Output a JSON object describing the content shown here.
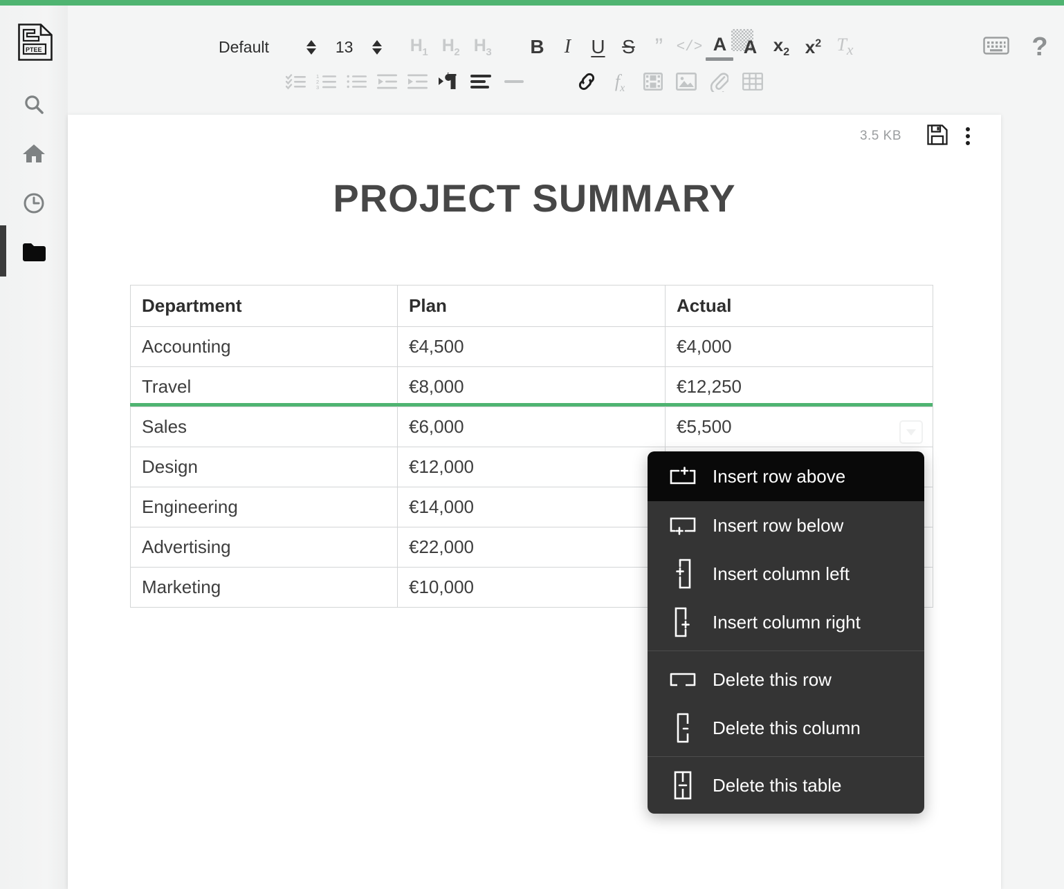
{
  "app": {
    "accent_color": "#4fb471",
    "logo_name": "ptee-document-logo"
  },
  "sidebar": {
    "items": [
      {
        "name": "search",
        "label": "Search",
        "icon": "search-icon",
        "active": false
      },
      {
        "name": "home",
        "label": "Home",
        "icon": "home-icon",
        "active": false
      },
      {
        "name": "recent",
        "label": "Recent",
        "icon": "clock-icon",
        "active": false
      },
      {
        "name": "files",
        "label": "Files",
        "icon": "folder-icon",
        "active": true
      }
    ]
  },
  "toolbar": {
    "paragraph_style": "Default",
    "font_size": "13",
    "row1": [
      {
        "name": "paragraph-style-select",
        "label": "Default",
        "type": "text"
      },
      {
        "name": "paragraph-style-stepper",
        "label": "",
        "type": "stepper"
      },
      {
        "name": "font-size-value",
        "label": "13",
        "type": "text"
      },
      {
        "name": "font-size-stepper",
        "label": "",
        "type": "stepper"
      },
      {
        "name": "heading-1-button",
        "label": "H1",
        "type": "heading",
        "enabled": false
      },
      {
        "name": "heading-2-button",
        "label": "H2",
        "type": "heading",
        "enabled": false
      },
      {
        "name": "heading-3-button",
        "label": "H3",
        "type": "heading",
        "enabled": false
      },
      {
        "name": "bold-button",
        "label": "B",
        "type": "fmt",
        "enabled": true
      },
      {
        "name": "italic-button",
        "label": "I",
        "type": "fmt",
        "enabled": true
      },
      {
        "name": "underline-button",
        "label": "U",
        "type": "fmt",
        "enabled": true
      },
      {
        "name": "strikethrough-button",
        "label": "S",
        "type": "fmt",
        "enabled": true
      },
      {
        "name": "blockquote-button",
        "label": "”",
        "type": "fmt",
        "enabled": false
      },
      {
        "name": "inline-code-button",
        "label": "</>",
        "type": "fmt",
        "enabled": false
      },
      {
        "name": "text-color-button",
        "label": "A",
        "type": "fmt",
        "enabled": true
      },
      {
        "name": "highlight-color-button",
        "label": "A",
        "type": "fmt",
        "enabled": true
      },
      {
        "name": "subscript-button",
        "label": "x2",
        "type": "fmt",
        "enabled": true
      },
      {
        "name": "superscript-button",
        "label": "x2",
        "type": "fmt",
        "enabled": true
      },
      {
        "name": "clear-formatting-button",
        "label": "Tx",
        "type": "fmt",
        "enabled": false
      }
    ],
    "row2": [
      {
        "name": "checklist-button",
        "label": "Checklist",
        "icon": "checklist-icon"
      },
      {
        "name": "numbered-list-button",
        "label": "Numbered list",
        "icon": "ordered-list-icon"
      },
      {
        "name": "bulleted-list-button",
        "label": "Bulleted list",
        "icon": "bulleted-list-icon"
      },
      {
        "name": "outdent-button",
        "label": "Decrease indent",
        "icon": "outdent-icon"
      },
      {
        "name": "indent-button",
        "label": "Increase indent",
        "icon": "indent-icon"
      },
      {
        "name": "text-direction-button",
        "label": "Text direction",
        "icon": "paragraph-direction-icon"
      },
      {
        "name": "align-button",
        "label": "Align",
        "icon": "align-icon"
      },
      {
        "name": "horizontal-rule-button",
        "label": "Horizontal rule",
        "icon": "horizontal-rule-icon"
      },
      {
        "name": "insert-link-button",
        "label": "Insert link",
        "icon": "link-icon"
      },
      {
        "name": "insert-formula-button",
        "label": "Insert formula",
        "icon": "formula-icon"
      },
      {
        "name": "insert-video-button",
        "label": "Insert video",
        "icon": "video-icon"
      },
      {
        "name": "insert-image-button",
        "label": "Insert image",
        "icon": "image-icon"
      },
      {
        "name": "attach-file-button",
        "label": "Attach file",
        "icon": "paperclip-icon"
      },
      {
        "name": "insert-table-button",
        "label": "Insert table",
        "icon": "table-icon"
      }
    ],
    "right": [
      {
        "name": "keyboard-shortcuts-button",
        "label": "Keyboard shortcuts",
        "icon": "keyboard-icon"
      },
      {
        "name": "help-button",
        "label": "Help",
        "icon": "question-mark-icon"
      }
    ]
  },
  "document": {
    "file_size": "3.5 KB",
    "save_label": "Save",
    "more_label": "More options",
    "title": "PROJECT SUMMARY"
  },
  "table": {
    "headers": [
      "Department",
      "Plan",
      "Actual"
    ],
    "rows": [
      {
        "department": "Accounting",
        "plan": "€4,500",
        "actual": "€4,000"
      },
      {
        "department": "Travel",
        "plan": "€8,000",
        "actual": "€12,250"
      },
      {
        "department": "Sales",
        "plan": "€6,000",
        "actual": "€5,500"
      },
      {
        "department": "Design",
        "plan": "€12,000",
        "actual": ""
      },
      {
        "department": "Engineering",
        "plan": "€14,000",
        "actual": ""
      },
      {
        "department": "Advertising",
        "plan": "€22,000",
        "actual": ""
      },
      {
        "department": "Marketing",
        "plan": "€10,000",
        "actual": ""
      }
    ],
    "highlight_color": "#4fb471",
    "highlight_after_row": 2
  },
  "context_menu": {
    "groups": [
      {
        "items": [
          {
            "name": "insert-row-above",
            "label": "Insert row above",
            "icon": "insert-row-above-icon",
            "active": true
          },
          {
            "name": "insert-row-below",
            "label": "Insert row below",
            "icon": "insert-row-below-icon",
            "active": false
          },
          {
            "name": "insert-column-left",
            "label": "Insert column left",
            "icon": "insert-column-left-icon",
            "active": false
          },
          {
            "name": "insert-column-right",
            "label": "Insert column right",
            "icon": "insert-column-right-icon",
            "active": false
          }
        ]
      },
      {
        "items": [
          {
            "name": "delete-this-row",
            "label": "Delete this row",
            "icon": "delete-row-icon",
            "active": false
          },
          {
            "name": "delete-this-column",
            "label": "Delete this column",
            "icon": "delete-column-icon",
            "active": false
          }
        ]
      },
      {
        "items": [
          {
            "name": "delete-this-table",
            "label": "Delete this table",
            "icon": "delete-table-icon",
            "active": false
          }
        ]
      }
    ]
  }
}
